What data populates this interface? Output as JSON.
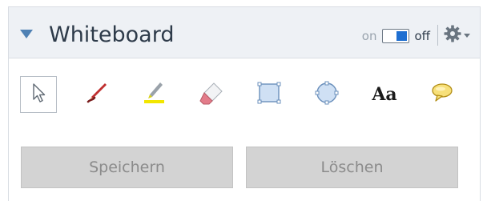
{
  "panel": {
    "title": "Whiteboard",
    "toggle": {
      "on_label": "on",
      "off_label": "off",
      "state": "off"
    },
    "settings_icon": "gear-icon"
  },
  "tools": [
    {
      "id": "select",
      "icon": "pointer-arrow-icon",
      "selected": true
    },
    {
      "id": "pen",
      "icon": "pen-icon",
      "selected": false
    },
    {
      "id": "highlighter",
      "icon": "highlighter-icon",
      "selected": false
    },
    {
      "id": "eraser",
      "icon": "eraser-icon",
      "selected": false
    },
    {
      "id": "rectangle",
      "icon": "rectangle-icon",
      "selected": false
    },
    {
      "id": "ellipse",
      "icon": "ellipse-icon",
      "selected": false
    },
    {
      "id": "text",
      "icon": "text-icon",
      "label": "Aa",
      "selected": false
    },
    {
      "id": "comment",
      "icon": "speech-bubble-icon",
      "selected": false
    }
  ],
  "actions": {
    "save_label": "Speichern",
    "delete_label": "Löschen"
  },
  "colors": {
    "header_bg": "#eef1f5",
    "accent": "#4f81b4",
    "pen": "#c03030",
    "highlighter": "#f2e600",
    "toggle_knob": "#1f6fd1",
    "button_bg": "#d3d3d3"
  }
}
